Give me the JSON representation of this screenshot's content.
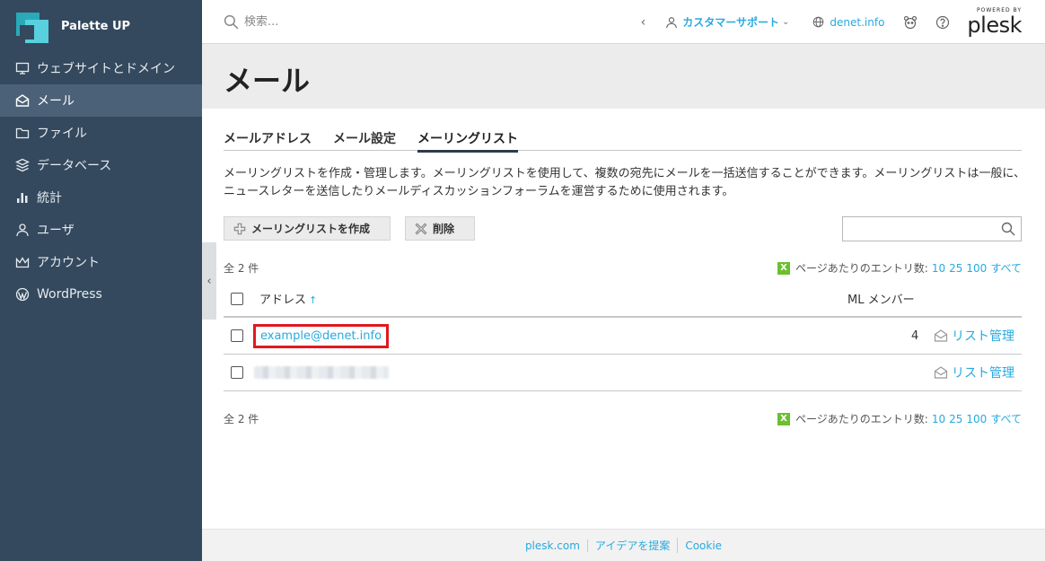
{
  "brand": {
    "name": "Palette UP"
  },
  "sidebar": {
    "items": [
      {
        "label": "ウェブサイトとドメイン",
        "icon": "monitor-icon"
      },
      {
        "label": "メール",
        "icon": "mail-icon",
        "active": true
      },
      {
        "label": "ファイル",
        "icon": "folder-icon"
      },
      {
        "label": "データベース",
        "icon": "database-icon"
      },
      {
        "label": "統計",
        "icon": "bar-chart-icon"
      },
      {
        "label": "ユーザ",
        "icon": "user-icon"
      },
      {
        "label": "アカウント",
        "icon": "crown-icon"
      },
      {
        "label": "WordPress",
        "icon": "wordpress-icon"
      }
    ]
  },
  "topbar": {
    "search_placeholder": "検索...",
    "account_label": "カスタマーサポート",
    "domain_label": "denet.info",
    "plesk_powered": "POWERED BY",
    "plesk_name": "plesk"
  },
  "page": {
    "title": "メール",
    "tabs": [
      {
        "label": "メールアドレス"
      },
      {
        "label": "メール設定"
      },
      {
        "label": "メーリングリスト",
        "active": true
      }
    ],
    "description": "メーリングリストを作成・管理します。メーリングリストを使用して、複数の宛先にメールを一括送信することができます。メーリングリストは一般に、ニュースレターを送信したりメールディスカッションフォーラムを運営するために使用されます。"
  },
  "toolbar": {
    "create_label": "メーリングリストを作成",
    "delete_label": "削除"
  },
  "list": {
    "total": "全 2 件",
    "per_page_label": "ページあたりのエントリ数:",
    "per_page_options": [
      "10",
      "25",
      "100",
      "すべて"
    ],
    "columns": {
      "address": "アドレス",
      "address_sort": "↑",
      "members": "ML メンバー"
    },
    "rows": [
      {
        "address": "example@denet.info",
        "members": "4",
        "action": "リスト管理"
      },
      {
        "address": "",
        "members": "",
        "action": "リスト管理"
      }
    ]
  },
  "footer": {
    "links": [
      "plesk.com",
      "アイデアを提案",
      "Cookie"
    ]
  },
  "colors": {
    "sidebar_bg": "#34495e",
    "sidebar_active": "#4b6178",
    "link": "#28aade",
    "highlight": "#e0191f"
  }
}
